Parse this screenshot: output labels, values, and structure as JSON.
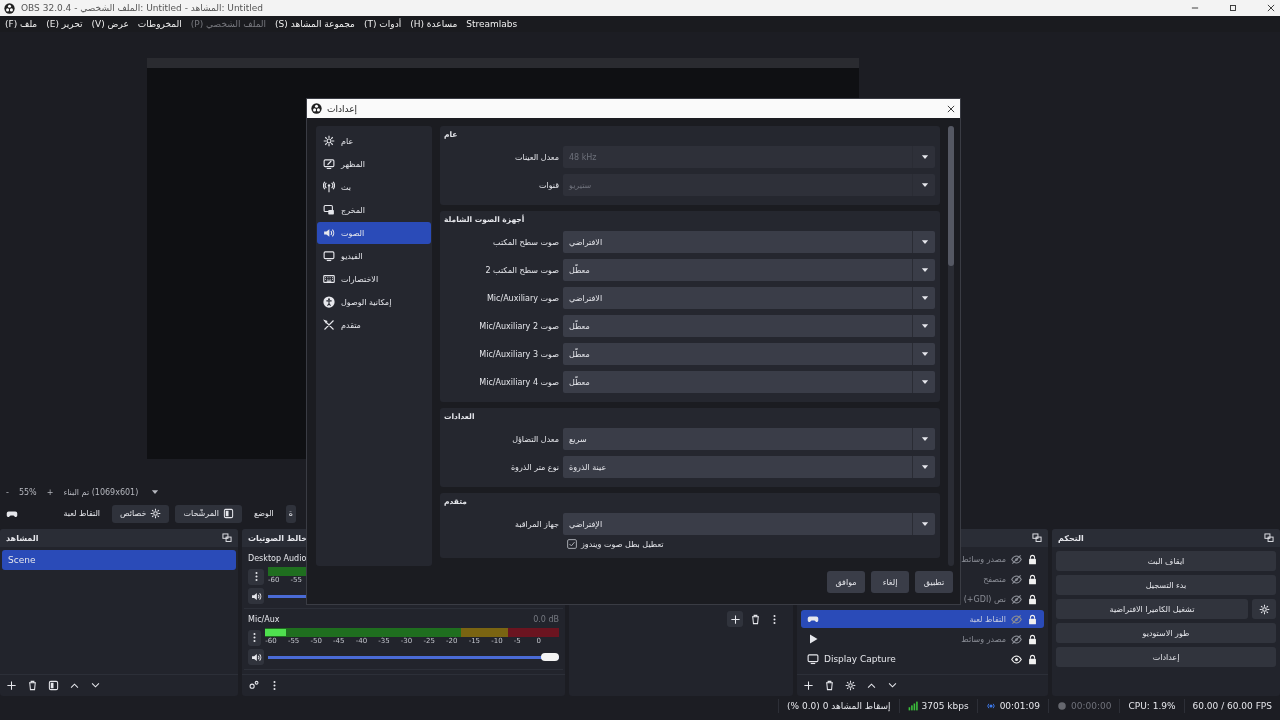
{
  "window": {
    "title": "OBS 32.0.4 - الملف الشخصي: Untitled - المشاهد: Untitled"
  },
  "menu": [
    {
      "label": "Streamlabs",
      "disabled": false
    },
    {
      "label": "مساعدة (H)",
      "disabled": false
    },
    {
      "label": "أدوات (T)",
      "disabled": false
    },
    {
      "label": "مجموعة المشاهد (S)",
      "disabled": false
    },
    {
      "label": "الملف الشخصي (P)",
      "disabled": true
    },
    {
      "label": "المخروطات",
      "disabled": false
    },
    {
      "label": "عرض (V)",
      "disabled": false
    },
    {
      "label": "تحرير (E)",
      "disabled": false
    },
    {
      "label": "ملف (F)",
      "disabled": false
    }
  ],
  "preview": {
    "zoom_out": "-",
    "zoom": "55%",
    "zoom_in": "+",
    "resolution": "تم البناء (1069x601)"
  },
  "source_toolbar": {
    "source": "التقاط لعبة",
    "buttons": [
      {
        "label": "المرشّحات",
        "kind": "filters"
      },
      {
        "label": "خصائص",
        "kind": "properties"
      }
    ],
    "mode": "الوضع",
    "cut_button": "ة"
  },
  "scenes": {
    "title": "المشاهد",
    "items": [
      {
        "name": "Scene",
        "selected": true
      }
    ]
  },
  "mixer": {
    "title": "خالط الصوتيات",
    "channels": [
      {
        "name": "Desktop Audio",
        "scale": [
          "-55",
          "-60"
        ],
        "meter": {
          "level": 0
        },
        "volume": {
          "level": 1
        }
      },
      {
        "name": "Mic/Aux",
        "reading": "0.0 dB",
        "scale": [
          "0",
          "-5",
          "-10",
          "-15",
          "-20",
          "-25",
          "-30",
          "-35",
          "-40",
          "-45",
          "-50",
          "-55",
          "-60"
        ],
        "meter": {
          "level": 0.07
        },
        "volume": {
          "level": 1
        }
      }
    ]
  },
  "sources": {
    "items": [
      {
        "name": "مصدر وسائط",
        "kind": "none",
        "visible": false,
        "locked": true,
        "selected": false
      },
      {
        "name": "متصفح",
        "kind": "none",
        "visible": false,
        "locked": true,
        "selected": false
      },
      {
        "name": "نص (GDI+)",
        "kind": "none",
        "visible": false,
        "locked": true,
        "selected": false
      },
      {
        "name": "التقاط لعبة",
        "kind": "game",
        "visible": false,
        "locked": true,
        "selected": true
      },
      {
        "name": "مصدر وسائط",
        "kind": "media",
        "visible": false,
        "locked": true,
        "selected": false
      },
      {
        "name": "Display Capture",
        "kind": "display",
        "visible": true,
        "locked": true,
        "selected": false
      }
    ]
  },
  "controls": {
    "title": "التحكم",
    "buttons": [
      {
        "label": "ايقاف البث",
        "settings": false
      },
      {
        "label": "بدء التسجيل",
        "settings": false
      },
      {
        "label": "تشغيل الكاميرا الافتراضية",
        "settings": true
      },
      {
        "label": "طور الاستوديو",
        "settings": false
      },
      {
        "label": "إعدادات",
        "settings": false
      }
    ]
  },
  "status_bar": {
    "dropped": "إسقاط المشاهد 0 (0.0 %)",
    "bitrate": "3705 kbps",
    "streaming": true,
    "stream_time": "00:01:09",
    "recording": false,
    "record_time": "00:00:00",
    "cpu": "CPU: 1.9%",
    "fps": "60.00 / 60.00 FPS"
  },
  "settings_dialog": {
    "title": "إعدادات",
    "nav": [
      {
        "label": "عام",
        "kind": "general",
        "selected": false
      },
      {
        "label": "المظهر",
        "kind": "appearance",
        "selected": false
      },
      {
        "label": "بث",
        "kind": "stream",
        "selected": false
      },
      {
        "label": "المخرج",
        "kind": "output",
        "selected": false
      },
      {
        "label": "الصوت",
        "kind": "audio",
        "selected": true
      },
      {
        "label": "الفيديو",
        "kind": "video",
        "selected": false
      },
      {
        "label": "الاختصارات",
        "kind": "hotkeys",
        "selected": false
      },
      {
        "label": "إمكانية الوصول",
        "kind": "accessibility",
        "selected": false
      },
      {
        "label": "متقدم",
        "kind": "advanced",
        "selected": false
      }
    ],
    "sections": [
      {
        "title": "عام",
        "rows": [
          {
            "label": "معدل العينات",
            "value": "48 kHz",
            "disabled": true
          },
          {
            "label": "قنوات",
            "value": "ستيريو",
            "disabled": true
          }
        ]
      },
      {
        "title": "أجهزة الصوت الشاملة",
        "rows": [
          {
            "label": "صوت سطح المكتب",
            "value": "الافتراضي",
            "disabled": false
          },
          {
            "label": "صوت سطح المكتب 2",
            "value": "معطّل",
            "disabled": false
          },
          {
            "label": "صوت Mic/Auxiliary",
            "value": "الافتراضي",
            "disabled": false
          },
          {
            "label": "صوت Mic/Auxiliary 2",
            "value": "معطّل",
            "disabled": false
          },
          {
            "label": "صوت Mic/Auxiliary 3",
            "value": "معطّل",
            "disabled": false
          },
          {
            "label": "صوت Mic/Auxiliary 4",
            "value": "معطّل",
            "disabled": false
          }
        ]
      },
      {
        "title": "العدادات",
        "rows": [
          {
            "label": "معدل التضاؤل",
            "value": "سريع",
            "disabled": false
          },
          {
            "label": "نوع متر الذروة",
            "value": "عينة الذروة",
            "disabled": false
          }
        ]
      },
      {
        "title": "متقدم",
        "rows": [
          {
            "label": "جهاز المراقبة",
            "value": "الإفتراضي",
            "disabled": false
          }
        ],
        "checkboxes": [
          {
            "label": "تعطيل بطل صوت ويندوز",
            "checked": true
          }
        ]
      }
    ],
    "buttons": [
      "تطبيق",
      "إلغاء",
      "موافق"
    ]
  }
}
